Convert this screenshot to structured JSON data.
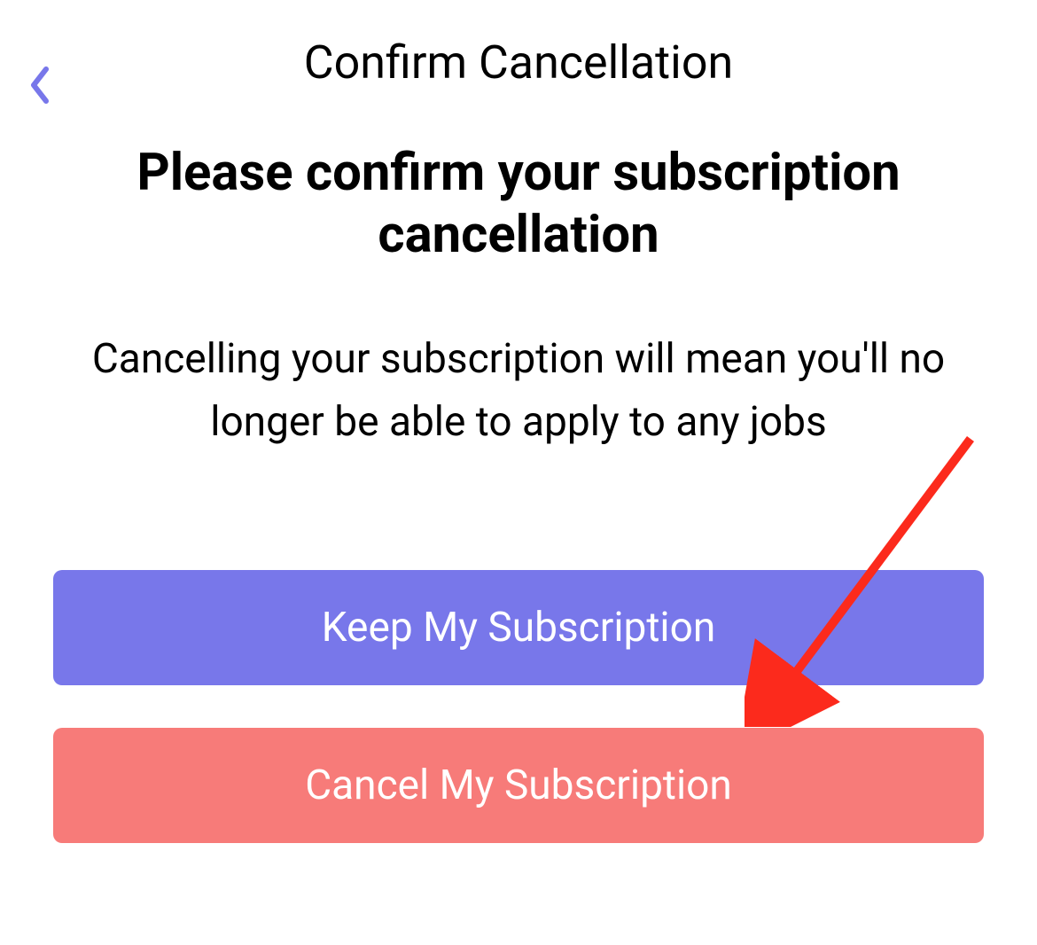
{
  "header": {
    "title": "Confirm Cancellation"
  },
  "content": {
    "heading": "Please confirm your subscription cancellation",
    "description": "Cancelling your subscription will mean you'll no longer be able to apply to any jobs"
  },
  "buttons": {
    "keep_label": "Keep My Subscription",
    "cancel_label": "Cancel My Subscription"
  },
  "colors": {
    "primary": "#7877ea",
    "danger": "#f77b79",
    "annotation": "#fc2a1c"
  }
}
